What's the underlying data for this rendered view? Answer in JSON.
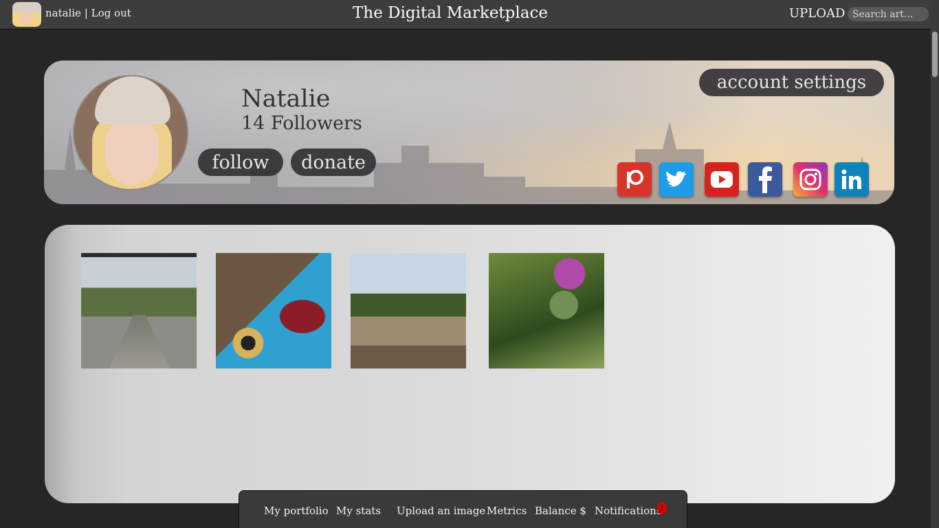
{
  "topbar": {
    "username": "natalie",
    "separator": "|",
    "logout_label": "Log out",
    "site_title": "The Digital Marketplace",
    "upload_label": "UPLOAD",
    "search_placeholder": "Search art..."
  },
  "profile": {
    "name": "Natalie",
    "followers": "14 Followers",
    "follow_label": "follow",
    "donate_label": "donate",
    "settings_label": "account settings",
    "social_icons": [
      "patreon-icon",
      "twitter-icon",
      "youtube-icon",
      "facebook-icon",
      "instagram-icon",
      "linkedin-icon"
    ]
  },
  "gallery": {
    "images": [
      "tree-lined-path",
      "butterfly",
      "formal-garden",
      "thistle"
    ]
  },
  "bottom_nav": {
    "portfolio": "My portfolio",
    "stats": "My stats",
    "upload": "Upload an image",
    "metrics": "Metrics",
    "balance": "Balance $",
    "notifications": "Notifications",
    "notification_count": "1"
  },
  "colors": {
    "background": "#262626",
    "topbar": "#3d3d3d",
    "pill_button": "#2d2a30",
    "notification_badge": "#e00000"
  }
}
